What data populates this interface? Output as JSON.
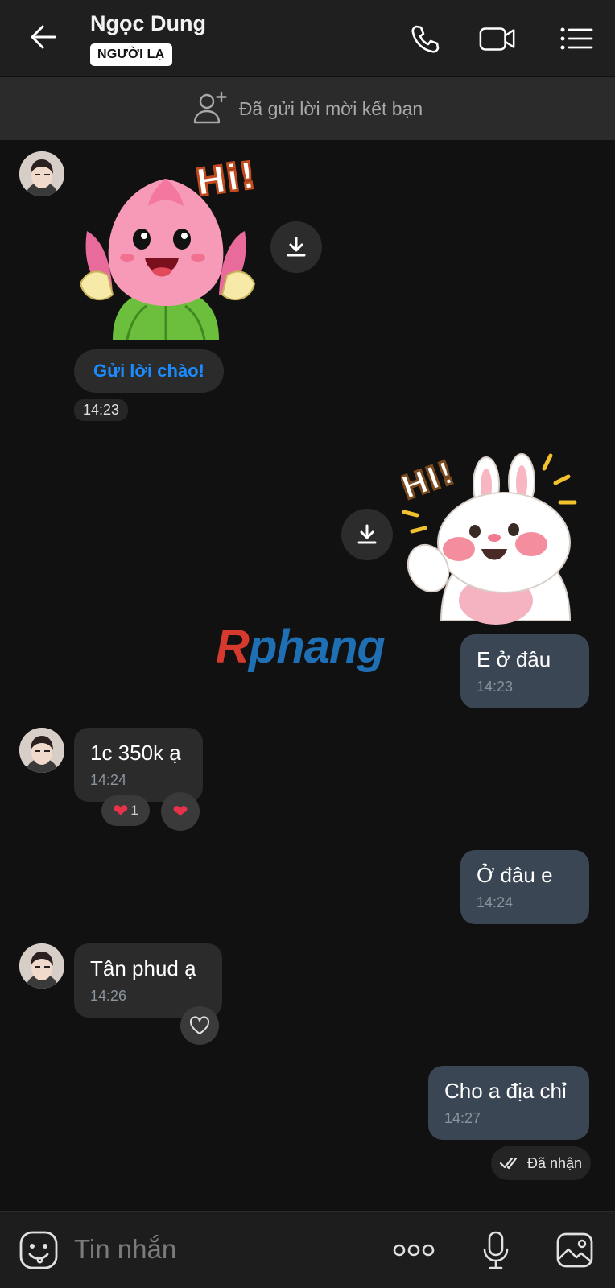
{
  "header": {
    "contact_name": "Ngọc Dung",
    "badge": "NGƯỜI LẠ",
    "icons": [
      "back-arrow-icon",
      "phone-icon",
      "video-call-icon",
      "menu-list-icon"
    ]
  },
  "friend_request": {
    "text": "Đã gửi lời mời kết bạn",
    "icon": "add-friend-icon"
  },
  "conversation": {
    "greeting_sticker": {
      "caption": "Hi!",
      "button_label": "Gửi lời chào!",
      "time": "14:23"
    },
    "sent_sticker": {
      "caption": "HI!"
    },
    "messages": [
      {
        "direction": "out",
        "text": "E ở đâu",
        "time": "14:23"
      },
      {
        "direction": "in",
        "text": "1c 350k ạ",
        "time": "14:24",
        "reaction_count": "1"
      },
      {
        "direction": "out",
        "text": "Ở đâu e",
        "time": "14:24"
      },
      {
        "direction": "in",
        "text": "Tân phud ạ",
        "time": "14:26"
      },
      {
        "direction": "out",
        "text": "Cho a địa chỉ",
        "time": "14:27"
      }
    ],
    "status": "Đã nhận"
  },
  "watermark": {
    "first": "R",
    "rest": "phang"
  },
  "input_bar": {
    "placeholder": "Tin nhắn",
    "icons": [
      "emoji-icon",
      "more-icon",
      "microphone-icon",
      "image-icon"
    ]
  },
  "colors": {
    "background": "#111111",
    "incoming_bubble": "#2b2b2b",
    "outgoing_bubble": "#3a4654",
    "accent_blue": "#1a8cff",
    "heart_red": "#e8324a"
  }
}
